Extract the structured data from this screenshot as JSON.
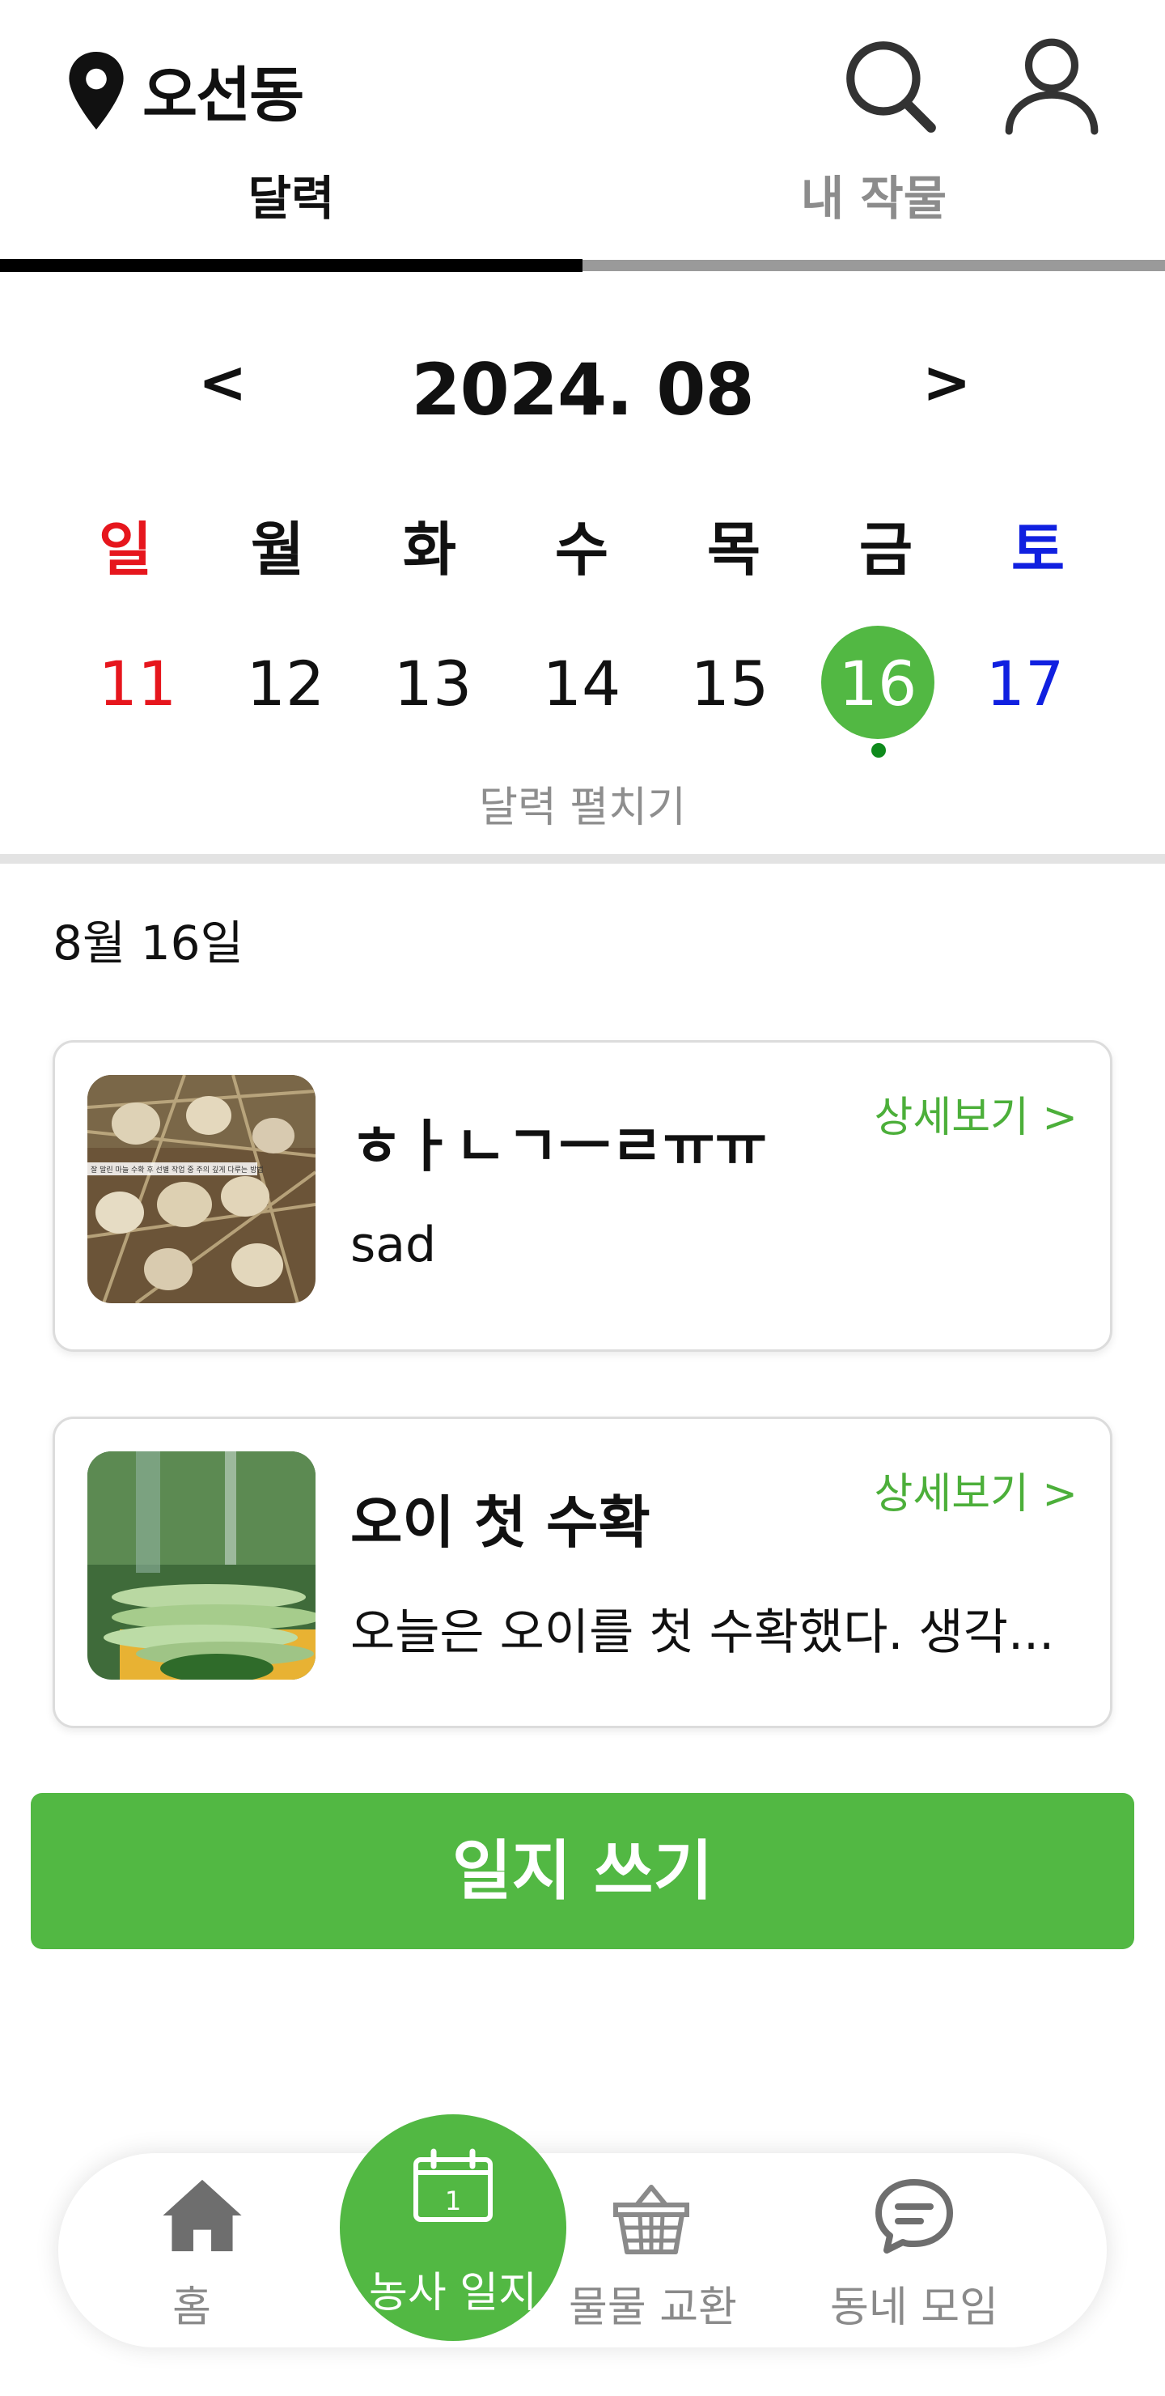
{
  "header": {
    "location": "오선동",
    "icons": [
      "location-pin-icon",
      "search-icon",
      "user-icon"
    ]
  },
  "tabs": [
    {
      "label": "달력",
      "active": true
    },
    {
      "label": "내 작물",
      "active": false
    }
  ],
  "calendar": {
    "prev": "<",
    "month": "2024. 08",
    "next": ">",
    "weekdays": [
      "일",
      "월",
      "화",
      "수",
      "목",
      "금",
      "토"
    ],
    "dates": [
      "11",
      "12",
      "13",
      "14",
      "15",
      "16",
      "17"
    ],
    "selected": "16",
    "expand_label": "달력 펼치기"
  },
  "selected_date_label": "8월 16일",
  "entries": [
    {
      "title": "ㅎㅏㄴㄱㅡㄹㅠㅠ",
      "body": "sad",
      "link": "상세보기 >",
      "image": "garlic-photo",
      "image_caption": "잘 말린 마늘 수확 후 선별 작업 중 주의 깊게 다루는 방법"
    },
    {
      "title": "오이 첫 수확",
      "body": "오늘은 오이를 첫 수확했다. 생각...",
      "link": "상세보기 >",
      "image": "cucumber-photo"
    }
  ],
  "write_button": "일지 쓰기",
  "bottom_nav": [
    {
      "label": "홈",
      "icon": "home-icon"
    },
    {
      "label": "농사 일지",
      "icon": "calendar-icon",
      "icon_text": "1",
      "active": true
    },
    {
      "label": "물물 교환",
      "icon": "basket-icon"
    },
    {
      "label": "동네 모임",
      "icon": "chat-bubble-icon"
    }
  ],
  "colors": {
    "accent": "#52b843",
    "link": "#4caf3a",
    "sunday": "#e6161d",
    "saturday": "#1020e0",
    "inactive": "#8a8a8a"
  }
}
